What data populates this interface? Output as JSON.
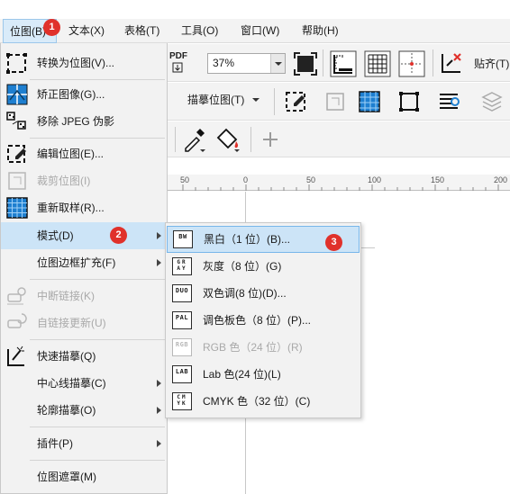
{
  "menubar": {
    "items": [
      {
        "label": "位图(B)",
        "badge": "1"
      },
      {
        "label": "文本(X)"
      },
      {
        "label": "表格(T)"
      },
      {
        "label": "工具(O)"
      },
      {
        "label": "窗口(W)"
      },
      {
        "label": "帮助(H)"
      }
    ]
  },
  "toolbar1": {
    "pdf_label": "PDF",
    "zoom_value": "37%",
    "snap_label": "贴齐(T)"
  },
  "toolbar2": {
    "trace_label": "描摹位图(T)"
  },
  "ruler": {
    "labels": [
      "50",
      "0",
      "50",
      "100",
      "150",
      "200"
    ]
  },
  "bitmap_menu": {
    "items": [
      {
        "label": "转换为位图(V)...",
        "icon": "convert-bitmap-icon"
      },
      {
        "label": "矫正图像(G)...",
        "icon": "straighten-image-icon"
      },
      {
        "label": "移除 JPEG 伪影",
        "icon": "remove-jpeg-artifacts-icon"
      },
      {
        "label": "编辑位图(E)...",
        "icon": "edit-bitmap-icon"
      },
      {
        "label": "裁剪位图(I)",
        "icon": "crop-bitmap-icon",
        "disabled": true
      },
      {
        "label": "重新取样(R)...",
        "icon": "resample-icon"
      },
      {
        "label": "模式(D)",
        "badge": "2",
        "submenu": true
      },
      {
        "label": "位图边框扩充(F)",
        "submenu": true
      },
      {
        "label": "中断链接(K)",
        "icon": "break-link-icon",
        "disabled": true
      },
      {
        "label": "自链接更新(U)",
        "icon": "update-link-icon",
        "disabled": true
      },
      {
        "label": "快速描摹(Q)",
        "icon": "quick-trace-icon"
      },
      {
        "label": "中心线描摹(C)",
        "submenu": true
      },
      {
        "label": "轮廓描摹(O)",
        "submenu": true
      },
      {
        "label": "插件(P)",
        "submenu": true
      },
      {
        "label": "位图遮罩(M)"
      }
    ]
  },
  "mode_submenu": {
    "items": [
      {
        "label": "黑白（1 位）(B)...",
        "icon_text": "BW",
        "badge": "3"
      },
      {
        "label": "灰度（8 位）(G)",
        "icon_text": "GRAY"
      },
      {
        "label": "双色调(8 位)(D)...",
        "icon_text": "DUO"
      },
      {
        "label": "调色板色（8 位）(P)...",
        "icon_text": "PAL"
      },
      {
        "label": "RGB 色（24 位）(R)",
        "icon_text": "RGB",
        "disabled": true
      },
      {
        "label": "Lab 色(24 位)(L)",
        "icon_text": "LAB"
      },
      {
        "label": "CMYK 色（32 位）(C)",
        "icon_text": "CMYK"
      }
    ]
  },
  "colors": {
    "menu_bg": "#f2f2f2",
    "highlight": "#cce4f7",
    "badge_red": "#e0312b",
    "disabled_text": "#a9a9a9"
  }
}
